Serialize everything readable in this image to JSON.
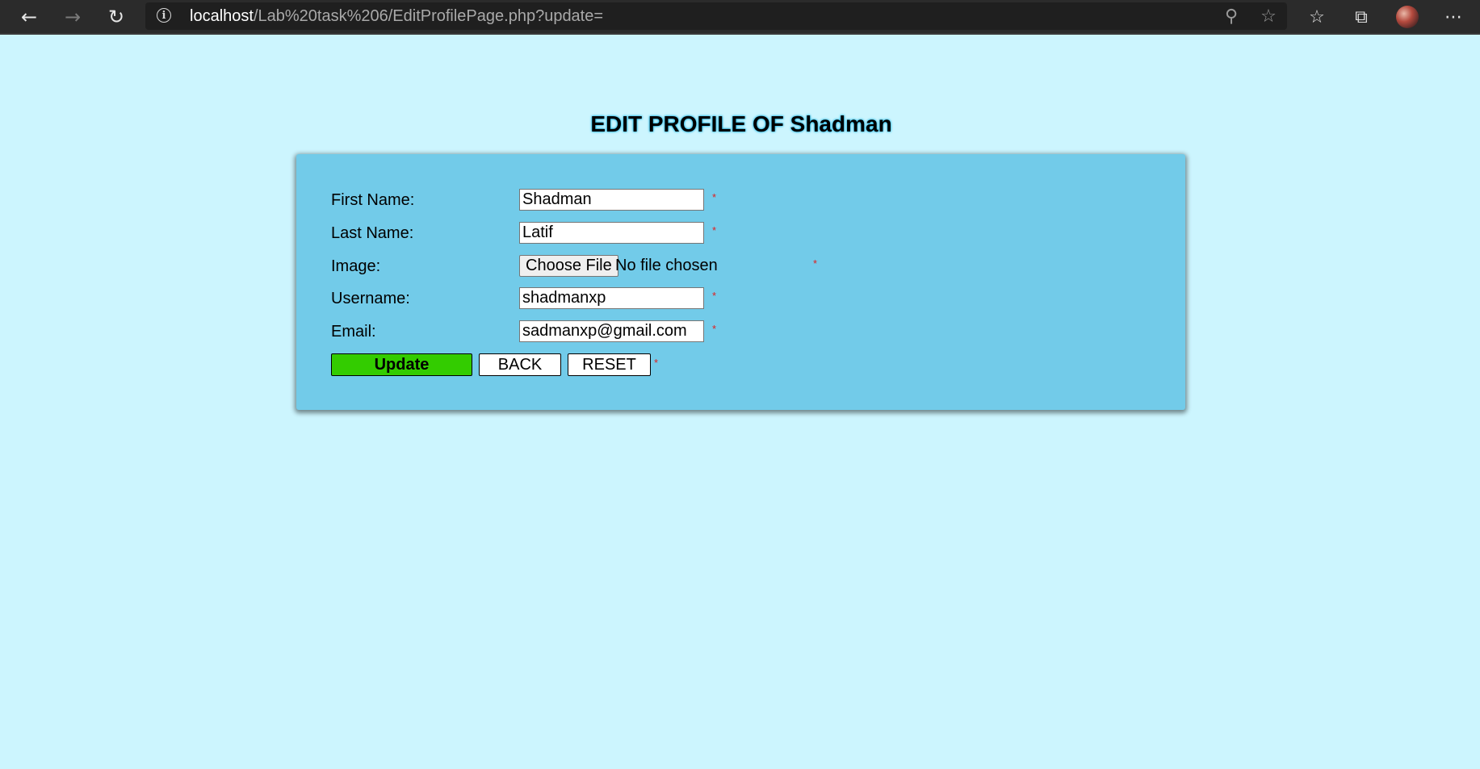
{
  "browser": {
    "url_host": "localhost",
    "url_path": "/Lab%20task%206/EditProfilePage.php?update="
  },
  "page": {
    "title": "EDIT PROFILE OF Shadman"
  },
  "form": {
    "first_name_label": "First Name:",
    "first_name_value": "Shadman",
    "last_name_label": "Last Name:",
    "last_name_value": "Latif",
    "image_label": "Image:",
    "choose_file_label": "Choose File",
    "no_file_text": "No file chosen",
    "username_label": "Username:",
    "username_value": "shadmanxp",
    "email_label": "Email:",
    "email_value": "sadmanxp@gmail.com",
    "required_mark": "*",
    "update_label": "Update",
    "back_label": "BACK",
    "reset_label": "RESET"
  },
  "colors": {
    "page_bg": "#ccf5fe",
    "panel_bg": "#72cbe9",
    "update_button": "#33cc00",
    "required_mark": "#e02020"
  },
  "icons": [
    "back-arrow-icon",
    "forward-arrow-icon",
    "refresh-icon",
    "info-icon",
    "zoom-icon",
    "star-icon",
    "favorites-icon",
    "collections-icon",
    "profile-avatar",
    "more-icon"
  ]
}
